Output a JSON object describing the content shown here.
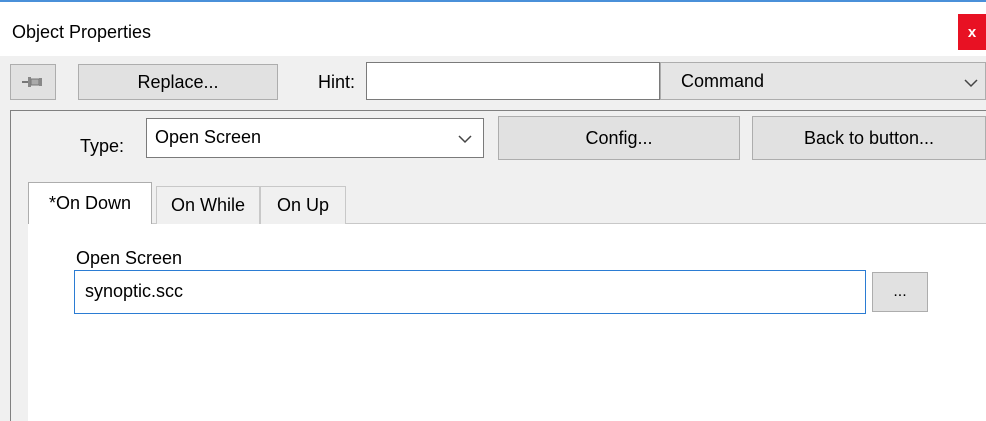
{
  "window": {
    "title": "Object Properties",
    "close_label": "x"
  },
  "toolbar": {
    "pin_icon": "pushpin-icon",
    "replace_label": "Replace...",
    "hint_label": "Hint:",
    "hint_value": "",
    "command_value": "Command"
  },
  "type_row": {
    "type_label": "Type:",
    "type_value": "Open Screen",
    "config_label": "Config...",
    "back_label": "Back to button..."
  },
  "tabs": [
    {
      "label": "*On Down",
      "active": true
    },
    {
      "label": "On While",
      "active": false
    },
    {
      "label": "On Up",
      "active": false
    }
  ],
  "tab_content": {
    "field_label": "Open Screen",
    "field_value": "synoptic.scc",
    "browse_label": "..."
  },
  "colors": {
    "close_bg": "#e81123",
    "focus_border": "#2b7cd3",
    "title_rule": "#4a90d9"
  }
}
